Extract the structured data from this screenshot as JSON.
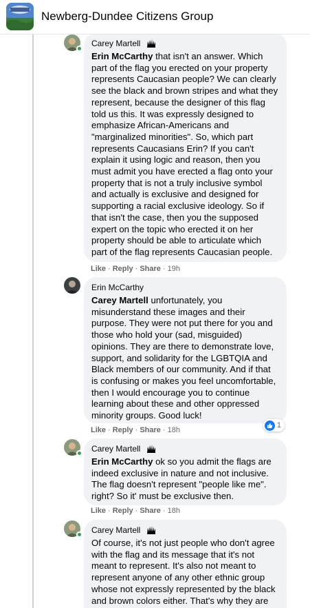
{
  "header": {
    "group_name": "Newberg-Dundee Citizens Group",
    "avatar_icon": "group-avatar-icon"
  },
  "comments": [
    {
      "author": "Carey Martell",
      "badge_icon": "top-fan-badge-icon",
      "mention": "Erin McCarthy",
      "text": " that isn't an answer. Which part of the flag you erected on your property represents Caucasian people? We can clearly see the black and brown stripes and what they represent, because the designer of this flag told us this. It was expressly designed to emphasize African-Americans and \"marginalized minorities\". So, which part represents Caucasians Erin? If you can't explain it using logic and reason, then you must admit you have erected a flag onto your property that is not a truly inclusive symbol and actually is exclusive and designed for supporting a racial exclusive ideology. So if that isn't the case, then you the supposed expert on the topic who erected it on her property should be able to articulate which part of the flag represents Caucasian people.",
      "actions": {
        "like": "Like",
        "reply": "Reply",
        "share": "Share",
        "time": "19h"
      }
    },
    {
      "author": "Erin McCarthy",
      "mention": "Carey Martell",
      "text": " unfortunately, you misunderstand these images and their purpose. They were not put there for you and those who hold your (sad, misguided) opinions. They are there to demonstrate love, support, and solidarity for the LGBTQIA and Black members of our community. And if that is confusing or makes you feel uncomfortable, then I would encourage you to continue learning about these and other oppressed minority groups. Good luck!",
      "actions": {
        "like": "Like",
        "reply": "Reply",
        "share": "Share",
        "time": "18h"
      },
      "reaction_count": "1",
      "reaction_icon": "like-reaction-icon"
    },
    {
      "author": "Carey Martell",
      "badge_icon": "top-fan-badge-icon",
      "mention": "Erin McCarthy",
      "text": " ok so you admit the flags are indeed exclusive in nature and not inclusive. The flag doesn't represent \"people like me\". right? So it' must be exclusive then.",
      "actions": {
        "like": "Like",
        "reply": "Reply",
        "share": "Share",
        "time": "18h"
      }
    },
    {
      "author": "Carey Martell",
      "badge_icon": "top-fan-badge-icon",
      "mention": "",
      "text": "Of course, it's not just people who don't agree with the flag and its message that it's not meant to represent. It's also not meant to represent anyone of any other ethnic group whose not expressly represented by the black and brown colors either. That's why they are"
    }
  ],
  "colors": {
    "bubble_bg": "#f0f2f5",
    "meta_text": "#65676b",
    "online": "#31a24c",
    "like_blue": "#1877f2"
  }
}
